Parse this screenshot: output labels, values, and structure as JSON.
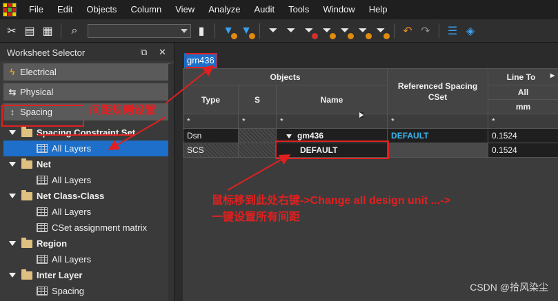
{
  "menubar": {
    "items": [
      "File",
      "Edit",
      "Objects",
      "Column",
      "View",
      "Analyze",
      "Audit",
      "Tools",
      "Window",
      "Help"
    ]
  },
  "worksheet_selector": {
    "title": "Worksheet Selector",
    "categories": [
      "Electrical",
      "Physical",
      "Spacing"
    ],
    "tree": [
      {
        "label": "Spacing Constraint Set",
        "children": [
          "All Layers"
        ]
      },
      {
        "label": "Net",
        "children": [
          "All Layers"
        ]
      },
      {
        "label": "Net Class-Class",
        "children": [
          "All Layers",
          "CSet assignment matrix"
        ]
      },
      {
        "label": "Region",
        "children": [
          "All Layers"
        ]
      },
      {
        "label": "Inter Layer",
        "children": [
          "Spacing"
        ]
      }
    ]
  },
  "sheet": {
    "tab": "gm436",
    "headers": {
      "objects": "Objects",
      "type": "Type",
      "s": "S",
      "name": "Name",
      "ref_cset": "Referenced Spacing CSet",
      "line_to": "Line To",
      "all": "All",
      "unit": "mm",
      "filter": "*"
    },
    "rows": [
      {
        "type": "Dsn",
        "name": "gm436",
        "cset": "DEFAULT",
        "value": "0.1524"
      },
      {
        "type": "SCS",
        "name": "DEFAULT",
        "cset": "",
        "value": "0.1524"
      }
    ]
  },
  "annotations": {
    "spacing_note": "间距规则设置",
    "rightclick_note_line1": "鼠标移到此处右键->Change all design unit ...->",
    "rightclick_note_line2": "一键设置所有间距"
  },
  "watermark": "CSDN @拾风染尘"
}
